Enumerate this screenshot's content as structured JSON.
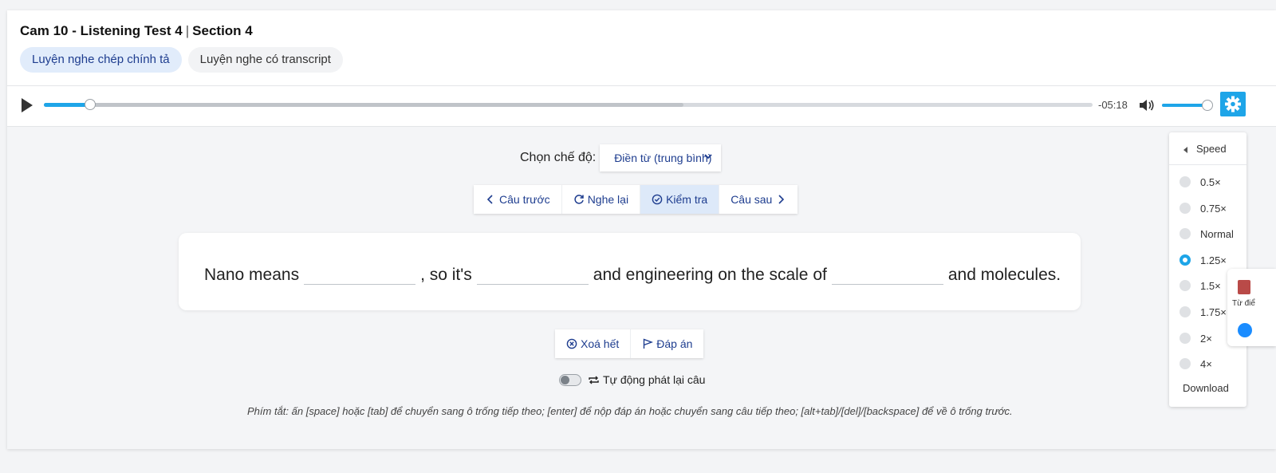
{
  "header": {
    "title": "Cam 10 - Listening Test 4",
    "separator": "|",
    "section": "Section 4",
    "tabs": [
      {
        "label": "Luyện nghe chép chính tả",
        "active": true
      },
      {
        "label": "Luyện nghe có transcript",
        "active": false
      }
    ]
  },
  "player": {
    "remaining_time": "-05:18",
    "played_fraction": 0.044,
    "buffered_fraction": 0.61,
    "volume_fraction": 0.93
  },
  "mode": {
    "label": "Chọn chế độ:",
    "selected": "Điền từ (trung bình)"
  },
  "nav_buttons": {
    "prev": "Câu trước",
    "replay": "Nghe lại",
    "check": "Kiểm tra",
    "next": "Câu sau"
  },
  "sentence": {
    "parts": [
      "Nano means",
      ", so it's",
      "and engineering on the scale of",
      "and molecules."
    ]
  },
  "actions": {
    "clear": "Xoá hết",
    "answer": "Đáp án"
  },
  "auto_replay": {
    "label": "Tự động phát lại câu",
    "enabled": false
  },
  "shortcut_hint": "Phím tắt: ấn [space] hoặc [tab] để chuyển sang ô trống tiếp theo; [enter] để nộp đáp án hoặc chuyển sang câu tiếp theo; [alt+tab]/[del]/[backspace] để về ô trống trước.",
  "speed_menu": {
    "title": "Speed",
    "options": [
      "0.5×",
      "0.75×",
      "Normal",
      "1.25×",
      "1.5×",
      "1.75×",
      "2×",
      "4×"
    ],
    "selected_index": 3,
    "download": "Download"
  },
  "side_widget": {
    "dict_label": "Từ điể"
  },
  "colors": {
    "accent": "#1ea5e8",
    "link": "#1e3d8f",
    "active_tab_bg": "#e1ecfb"
  }
}
